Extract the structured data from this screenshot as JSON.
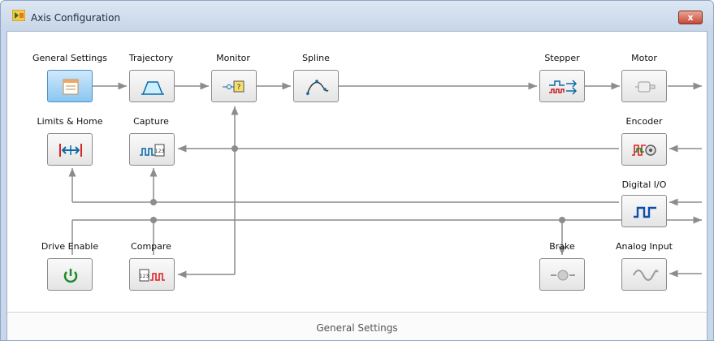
{
  "window": {
    "title": "Axis Configuration",
    "close_label": "x"
  },
  "nodes": {
    "general_settings": "General Settings",
    "trajectory": "Trajectory",
    "monitor": "Monitor",
    "spline": "Spline",
    "stepper": "Stepper",
    "motor": "Motor",
    "limits_home": "Limits & Home",
    "capture": "Capture",
    "encoder": "Encoder",
    "digital_io": "Digital I/O",
    "drive_enable": "Drive Enable",
    "compare": "Compare",
    "brake": "Brake",
    "analog_input": "Analog Input"
  },
  "panel": {
    "title": "General Settings"
  },
  "colors": {
    "selected": "#8ac6f0",
    "wire": "#8c8c8c",
    "close": "#c64a35"
  }
}
